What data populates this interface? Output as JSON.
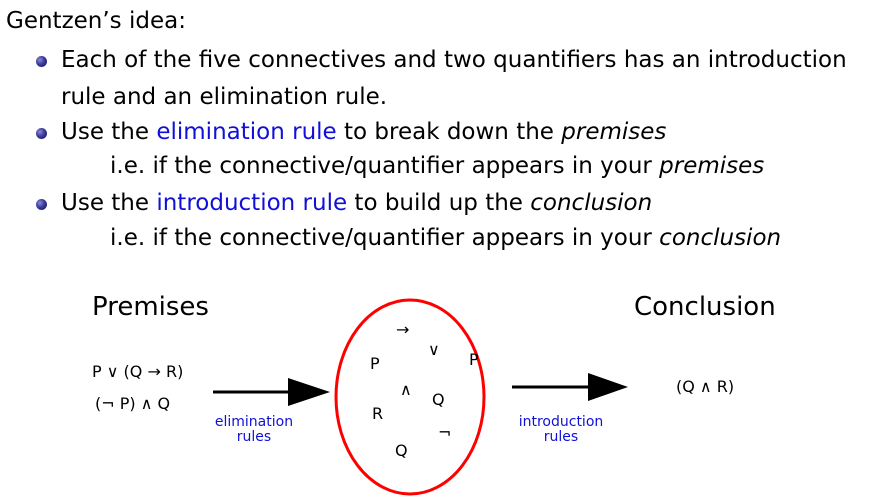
{
  "heading": "Gentzen’s idea:",
  "bullets": [
    {
      "line1": "Each of the five connectives and two quantifiers has an introduction",
      "line2": "rule and an elimination rule."
    },
    {
      "prefix": "Use the ",
      "highlight": "elimination rule",
      "middle": " to break down the ",
      "emph": "premises",
      "sub_prefix": "i.e. if the connective/quantifier appears in your ",
      "sub_emph": "premises"
    },
    {
      "prefix": "Use the ",
      "highlight": "introduction rule",
      "middle": " to build up the ",
      "emph": "conclusion",
      "sub_prefix": "i.e. if the connective/quantifier appears in your ",
      "sub_emph": "conclusion"
    }
  ],
  "diagram": {
    "premises_title": "Premises",
    "conclusion_title": "Conclusion",
    "premises": [
      "P ∨ (Q → R)",
      "(¬ P) ∧ Q"
    ],
    "elimination_label": [
      "elimination",
      "rules"
    ],
    "introduction_label": [
      "introduction",
      "rules"
    ],
    "circle_symbols": [
      "→",
      "∨",
      "P",
      "P",
      "∧",
      "Q",
      "R",
      "¬",
      "Q"
    ],
    "conclusion": "(Q ∧ R)",
    "colors": {
      "circle": "#ff0000",
      "rule_text": "#1010d8",
      "link_text": "#1010d8"
    }
  }
}
